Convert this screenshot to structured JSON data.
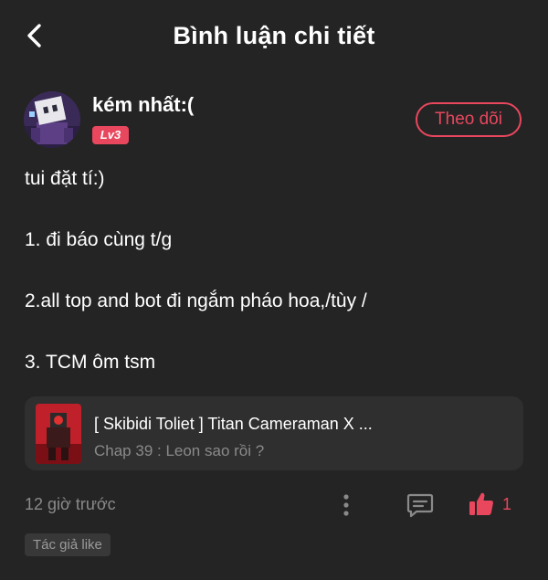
{
  "header": {
    "title": "Bình luận chi tiết",
    "back_icon": "chevron-left-icon"
  },
  "author": {
    "name": "kém nhất:(",
    "level": "Lv3",
    "follow_label": "Theo dõi"
  },
  "comment": {
    "lines": [
      "tui đặt tí:)",
      "1. đi báo cùng t/g",
      "2.all top and bot đi ngắm pháo hoa,/tùy /",
      "3. TCM ôm tsm"
    ]
  },
  "story": {
    "title": "[ Skibidi Toliet ] Titan Cameraman X ...",
    "chapter": "Chap 39 : Leon sao rồi ?"
  },
  "meta": {
    "time": "12 giờ trước",
    "like_count": "1",
    "author_liked": "Tác giả like"
  },
  "colors": {
    "background": "#242424",
    "accent": "#e8475e",
    "card": "#2f2f2f",
    "muted_text": "#8a8a8a"
  }
}
